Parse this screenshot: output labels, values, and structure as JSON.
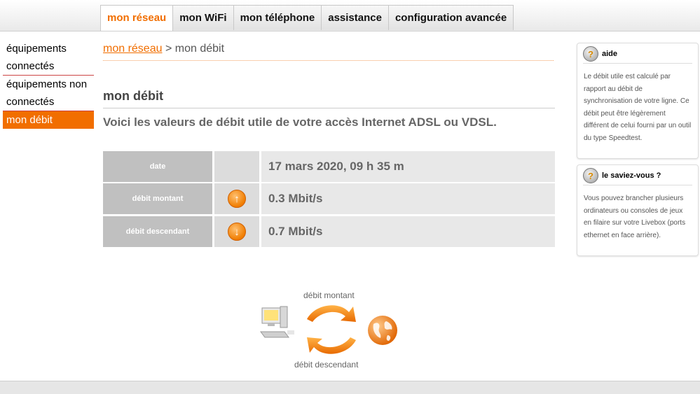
{
  "nav": {
    "tabs": [
      "mon réseau",
      "mon WiFi",
      "mon téléphone",
      "assistance",
      "configuration avancée"
    ],
    "active_tab": "mon réseau"
  },
  "sidebar": {
    "items": [
      {
        "label": "équipements connectés"
      },
      {
        "label": "équipements non connectés"
      },
      {
        "label": "mon débit"
      }
    ],
    "active_item": "mon débit"
  },
  "breadcrumb": {
    "parent": "mon réseau",
    "separator": ">",
    "current": "mon débit"
  },
  "main": {
    "title": "mon débit",
    "subtitle": "Voici les valeurs de débit utile de votre accès Internet ADSL ou VDSL.",
    "rows": [
      {
        "label": "date",
        "icon": "",
        "value": "17 mars 2020, 09 h 35 m"
      },
      {
        "label": "débit montant",
        "icon": "arrow-up-icon",
        "value": "0.3 Mbit/s"
      },
      {
        "label": "débit descendant",
        "icon": "arrow-down-icon",
        "value": "0.7 Mbit/s"
      }
    ]
  },
  "diagram": {
    "upload_label": "débit montant",
    "download_label": "débit descendant"
  },
  "help": {
    "title": "aide",
    "text": "Le débit utile est calculé par rapport au débit de synchronisation de votre ligne. Ce débit peut être légèrement différent de celui fourni par un outil du type Speedtest."
  },
  "tip": {
    "title": "le saviez-vous ?",
    "text": "Vous pouvez brancher plusieurs ordinateurs ou consoles de jeux en filaire sur votre Livebox (ports ethernet en face arrière)."
  },
  "colors": {
    "brand_orange": "#f16e00",
    "label_gray": "#c0c0c0",
    "value_gray": "#e8e8e8"
  }
}
